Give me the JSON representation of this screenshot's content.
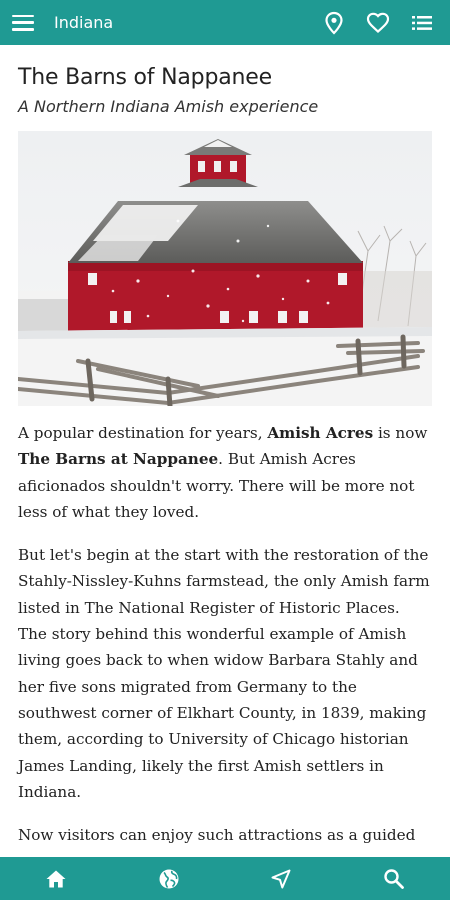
{
  "header": {
    "title": "Indiana",
    "icons": [
      "menu-icon",
      "location-pin-icon",
      "heart-icon",
      "list-icon"
    ]
  },
  "article": {
    "title": "The Barns of Nappanee",
    "subtitle": "A Northern Indiana Amish experience",
    "photo_description": "red-round-barn-in-snow",
    "p1": {
      "t1": "A popular destination for years, ",
      "b1": "Amish Acres",
      "t2": " is now ",
      "b2": "The Barns at Nappanee",
      "t3": ". But Amish Acres aficionados shouldn't worry. There will be more not less of what they loved."
    },
    "p2": "But let's begin at the start with the restoration of the Stahly-Nissley-Kuhns farmstead, the only Amish farm listed in The National Register of Historic Places. The story behind this wonderful example of Amish living goes back to when widow Barbara Stahly and her five sons migrated from Germany to the southwest corner of Elkhart County, in 1839, making them, according to University of Chicago historian James Landing, likely the first Amish settlers in Indiana.",
    "p3": "Now visitors can enjoy such attractions as a guided"
  },
  "bottom_nav": {
    "icons": [
      "home-icon",
      "globe-icon",
      "navigation-arrow-icon",
      "search-icon"
    ]
  },
  "colors": {
    "accent": "#1f9a93",
    "barn_red": "#b0182a"
  }
}
